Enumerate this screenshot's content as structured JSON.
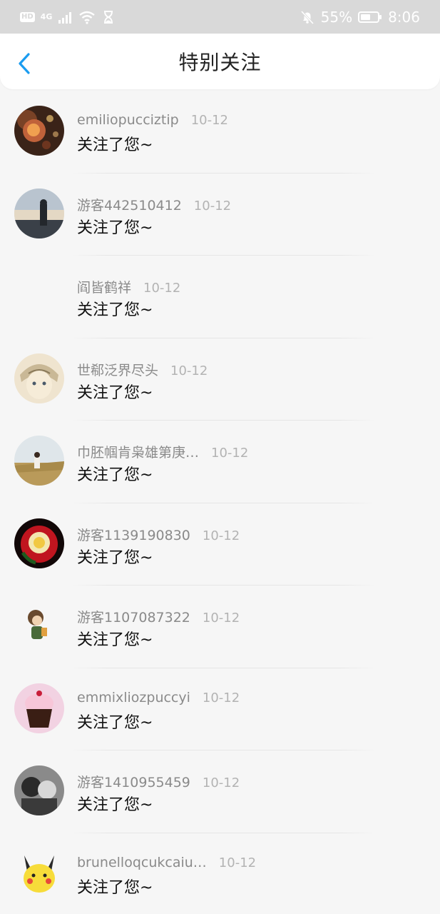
{
  "status_bar": {
    "hd": "HD",
    "network": "4G",
    "battery_percent": "55%",
    "time": "8:06"
  },
  "header": {
    "title": "特别关注"
  },
  "items": [
    {
      "name": "emiliopucciztip",
      "date": "10-12",
      "message": "关注了您~",
      "avatar": "lantern"
    },
    {
      "name": "游客442510412",
      "date": "10-12",
      "message": "关注了您~",
      "avatar": "sky-person"
    },
    {
      "name": "阎皆鹤祥",
      "date": "10-12",
      "message": "关注了您~",
      "avatar": "none"
    },
    {
      "name": "世郗泛界尽头",
      "date": "10-12",
      "message": "关注了您~",
      "avatar": "anime-sketch"
    },
    {
      "name": "巾胚帼肯枭雄第庚…",
      "date": "10-12",
      "message": "关注了您~",
      "avatar": "field-girl"
    },
    {
      "name": "游客1139190830",
      "date": "10-12",
      "message": "关注了您~",
      "avatar": "rose"
    },
    {
      "name": "游客1107087322",
      "date": "10-12",
      "message": "关注了您~",
      "avatar": "cartoon-kid"
    },
    {
      "name": "emmixliozpuccyi",
      "date": "10-12",
      "message": "关注了您~",
      "avatar": "cupcake"
    },
    {
      "name": "游客1410955459",
      "date": "10-12",
      "message": "关注了您~",
      "avatar": "bw-couple"
    },
    {
      "name": "brunelloqcukcaiu…",
      "date": "10-12",
      "message": "关注了您~",
      "avatar": "pikachu"
    }
  ],
  "colors": {
    "accent": "#1a9cf0",
    "status_bar_bg": "#d9d9d9",
    "page_bg": "#f6f6f6"
  }
}
